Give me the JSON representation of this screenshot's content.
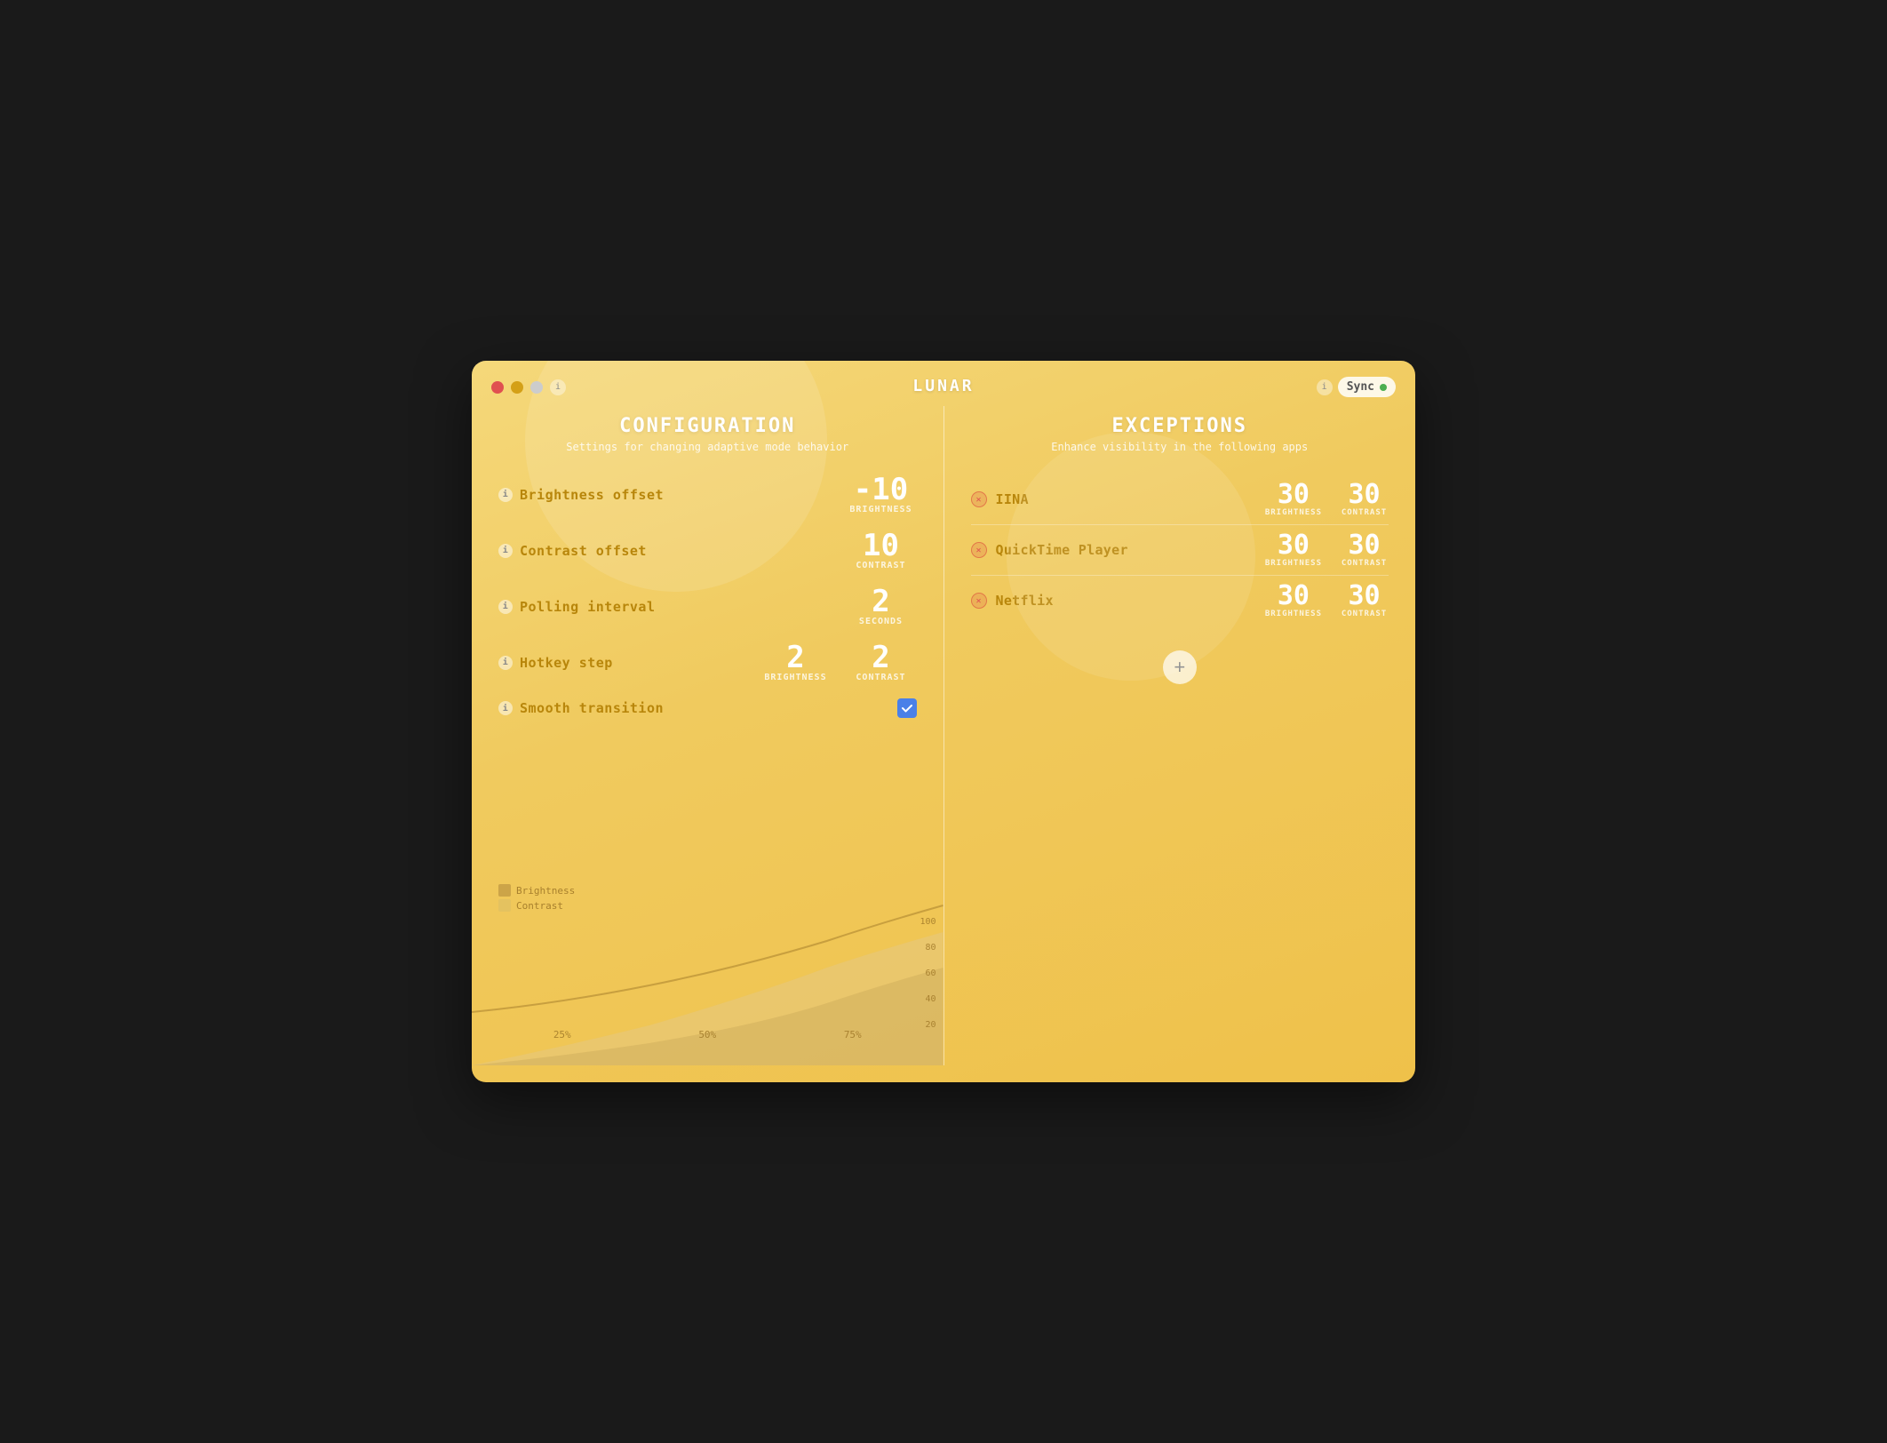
{
  "window": {
    "title": "LUNAR"
  },
  "titlebar": {
    "info_label": "i",
    "sync_label": "Sync",
    "sync_active": true
  },
  "configuration": {
    "title": "CONFIGURATION",
    "subtitle": "Settings for changing adaptive mode behavior",
    "rows": [
      {
        "id": "brightness-offset",
        "label": "Brightness offset",
        "value": "-10",
        "unit": "BRIGHTNESS"
      },
      {
        "id": "contrast-offset",
        "label": "Contrast offset",
        "value": "10",
        "unit": "CONTRAST"
      },
      {
        "id": "polling-interval",
        "label": "Polling interval",
        "value": "2",
        "unit": "SECONDS"
      }
    ],
    "hotkey_step": {
      "label": "Hotkey step",
      "brightness_value": "2",
      "brightness_unit": "BRIGHTNESS",
      "contrast_value": "2",
      "contrast_unit": "CONTRAST"
    },
    "smooth_transition": {
      "label": "Smooth transition",
      "checked": true
    }
  },
  "exceptions": {
    "title": "EXCEPTIONS",
    "subtitle": "Enhance visibility in the following apps",
    "apps": [
      {
        "name": "IINA",
        "brightness": "30",
        "contrast": "30"
      },
      {
        "name": "QuickTime Player",
        "brightness": "30",
        "contrast": "30"
      },
      {
        "name": "Netflix",
        "brightness": "30",
        "contrast": "30"
      }
    ],
    "add_label": "+"
  },
  "chart": {
    "x_labels": [
      "25%",
      "50%",
      "75%"
    ],
    "y_labels": [
      "20",
      "40",
      "60",
      "80",
      "100"
    ]
  },
  "legend": {
    "brightness_label": "Brightness",
    "contrast_label": "Contrast"
  }
}
